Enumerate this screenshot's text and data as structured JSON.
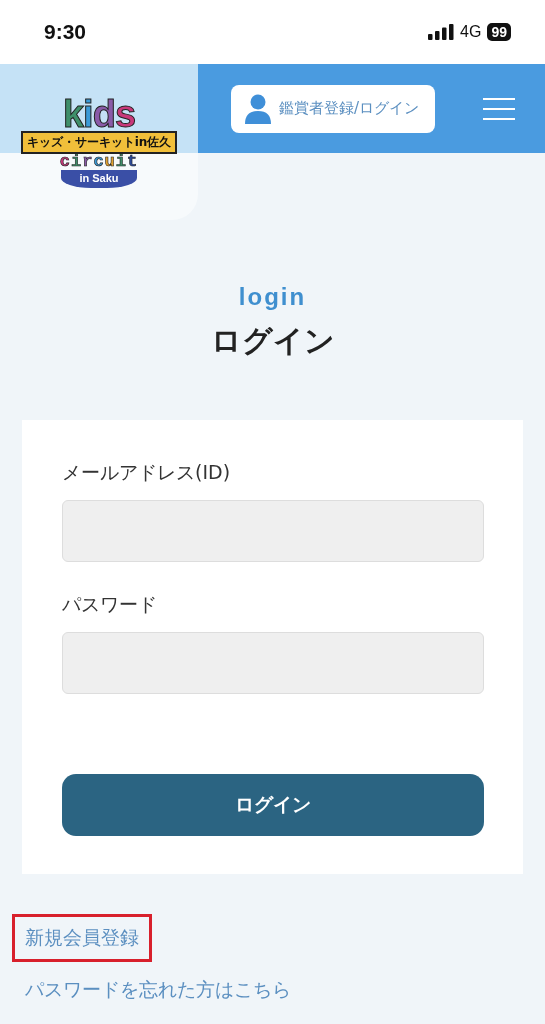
{
  "status_bar": {
    "time": "9:30",
    "network": "4G",
    "battery": "99"
  },
  "header": {
    "logo": {
      "word": "kids",
      "ribbon": "キッズ・サーキットin佐久",
      "subword": "circuit",
      "place": "in Saku"
    },
    "account_button": "鑑賞者登録/ログイン"
  },
  "page": {
    "eyebrow": "login",
    "title": "ログイン"
  },
  "form": {
    "fields": [
      {
        "label": "メールアドレス(ID)"
      },
      {
        "label": "パスワード"
      }
    ],
    "submit": "ログイン"
  },
  "links": [
    {
      "label": "新規会員登録",
      "highlighted": true
    },
    {
      "label": "パスワードを忘れた方はこちら",
      "highlighted": false
    }
  ]
}
